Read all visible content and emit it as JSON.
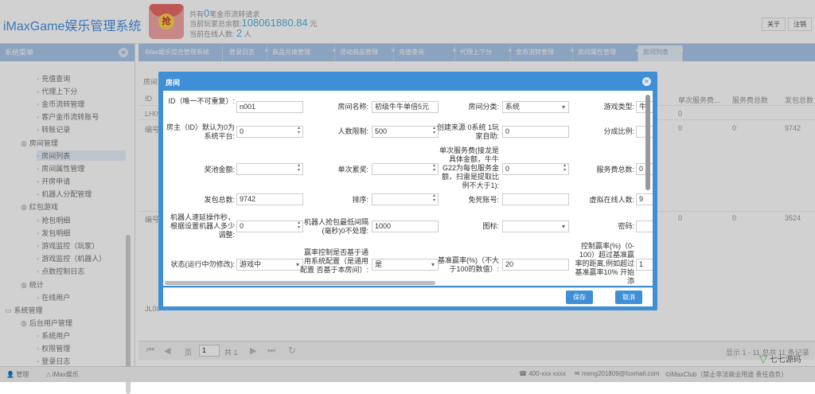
{
  "header": {
    "app_title": "iMaxGame娱乐管理系统",
    "redbag_glyph": "抢",
    "line1_pre": "共有",
    "line1_num": "0",
    "line1_post": "笔金币流转请求",
    "line2_pre": "当前玩家总余额:",
    "line2_num": "108061880.84",
    "line2_post": "元",
    "line3_pre": "当前在线人数:",
    "line3_num": "2",
    "line3_post": "人",
    "about": "关于",
    "logout": "注销"
  },
  "sidebar": {
    "title": "系统菜单",
    "toggle": "«",
    "items": [
      {
        "label": "充值查询",
        "indent": 2
      },
      {
        "label": "代理上下分",
        "indent": 2
      },
      {
        "label": "金币流转管理",
        "indent": 2
      },
      {
        "label": "客户金币流转账号",
        "indent": 2
      },
      {
        "label": "转账记录",
        "indent": 2
      },
      {
        "label": "房间管理",
        "indent": 1
      },
      {
        "label": "房间列表",
        "indent": 2,
        "active": true
      },
      {
        "label": "房间属性管理",
        "indent": 2
      },
      {
        "label": "开房申请",
        "indent": 2
      },
      {
        "label": "机器人分配管理",
        "indent": 2
      },
      {
        "label": "红包游戏",
        "indent": 1
      },
      {
        "label": "抢包明细",
        "indent": 2
      },
      {
        "label": "发包明细",
        "indent": 2
      },
      {
        "label": "游戏监控（玩家）",
        "indent": 2
      },
      {
        "label": "游戏监控（机器人）",
        "indent": 2
      },
      {
        "label": "点数控制日志",
        "indent": 2
      },
      {
        "label": "统计",
        "indent": 1
      },
      {
        "label": "在线用户",
        "indent": 2
      },
      {
        "label": "系统管理",
        "indent": 0
      },
      {
        "label": "后台用户管理",
        "indent": 1
      },
      {
        "label": "系统用户",
        "indent": 2
      },
      {
        "label": "权限管理",
        "indent": 2
      },
      {
        "label": "登录日志",
        "indent": 2
      }
    ]
  },
  "tabs": [
    {
      "label": "iMax娱乐综合管理系统"
    },
    {
      "label": "登录日志"
    },
    {
      "label": "商品兑换管理"
    },
    {
      "label": "活动商品管理"
    },
    {
      "label": "充值查询"
    },
    {
      "label": "代理上下分"
    },
    {
      "label": "金币流转管理"
    },
    {
      "label": "房间属性管理"
    },
    {
      "label": "房间列表",
      "active": true
    }
  ],
  "background": {
    "panel_title": "房间",
    "col_id": "ID",
    "col_headers": [
      "单次服务费...",
      "服务费总数",
      "发包总数"
    ],
    "row1": {
      "id": "LH00",
      "c1": "0",
      "c2": "0"
    },
    "row2": {
      "id": "编号",
      "c1": "0",
      "c2": "0",
      "c3": "9742"
    },
    "row3": {
      "id": "编号",
      "c1": "0",
      "c2": "0",
      "c3": "3524"
    },
    "row4": {
      "id": "JL00"
    },
    "page_label": "页",
    "page_value": "1",
    "page_total": "共 1",
    "page_info": "显示 1 - 11 总共 11 条记录"
  },
  "modal": {
    "title": "房间",
    "fields": {
      "id_label": "ID（唯一不可重复）:",
      "id_value": "n001",
      "room_name_label": "房间名称:",
      "room_name_value": "初级牛牛单倍5元",
      "category_label": "房间分类:",
      "category_value": "系统",
      "game_type_label": "游戏类型:",
      "game_type_value": "牛",
      "owner_label": "房主（ID）默认为0为系统平台:",
      "owner_value": "0",
      "limit_label": "人数限制:",
      "limit_value": "500",
      "source_label": "创建来源 0系统 1玩家自助:",
      "source_value": "0",
      "share_label": "分成比例:",
      "pool_label": "奖池金额:",
      "pool_value": "",
      "tired_label": "单次累奖:",
      "tired_value": "",
      "fee_label": "单次服务费(接龙是具体金额，牛牛G22为每包服务金额，扫雷是提取比例不大于1):",
      "fee_value": "0",
      "fee_total_label": "服务费总数:",
      "fee_total_value": "0",
      "send_total_label": "发包总数:",
      "send_total_value": "9742",
      "sort_label": "排序:",
      "sort_value": "",
      "free_label": "免死账号:",
      "free_value": "",
      "virtual_label": "虚拟在线人数:",
      "virtual_value": "9",
      "robot_delay_label": "机器人速延操作秒，根据设置机器人多少调整:",
      "robot_delay_value": "0",
      "robot_interval_label": "机器人抢包最低间隔(毫秒)0不处理:",
      "robot_interval_value": "1000",
      "icon_label": "图标:",
      "icon_value": "",
      "password_label": "密码:",
      "password_value": "",
      "status_label": "状态(运行中勿修改):",
      "status_value": "游戏中",
      "winctl_label": "赢率控制是否基于通用系统配置（是通用配置 否基于本房间）:",
      "winctl_value": "是",
      "base_rate_label": "基准赢率(%)（不大于100的数值）:",
      "base_rate_value": "20",
      "ctl_rate_label": "控制赢率(%)（0-100）超过基准赢率的距离,例如超过基准赢率10% 开始添",
      "ctl_rate_value": "1"
    },
    "save": "保存",
    "cancel": "取消"
  },
  "footer": {
    "admin": "管理",
    "org": "iMax娱乐",
    "phone": "400-xxx-xxxx",
    "email": "meng201809@foxmail.com",
    "copyright": "©iMaxClub（禁止非法商业用途 责任自负）",
    "watermark": "七七源码"
  }
}
